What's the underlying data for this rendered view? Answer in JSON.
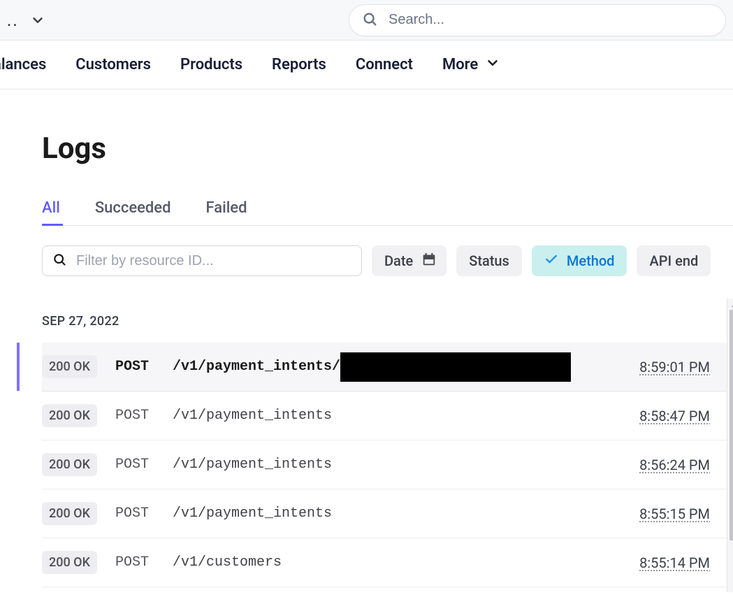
{
  "top": {
    "stub": "..",
    "search_placeholder": "Search..."
  },
  "nav": {
    "items": [
      "alances",
      "Customers",
      "Products",
      "Reports",
      "Connect",
      "More"
    ]
  },
  "page": {
    "title": "Logs"
  },
  "tabs": {
    "items": [
      "All",
      "Succeeded",
      "Failed"
    ],
    "active": 0
  },
  "filter": {
    "placeholder": "Filter by resource ID...",
    "chips": {
      "date": "Date",
      "status": "Status",
      "method": "Method",
      "api": "API end"
    }
  },
  "logs": {
    "date_header": "SEP 27, 2022",
    "rows": [
      {
        "status": "200 OK",
        "method": "POST",
        "path": "/v1/payment_intents/",
        "redacted": true,
        "time": "8:59:01 PM",
        "selected": true
      },
      {
        "status": "200 OK",
        "method": "POST",
        "path": "/v1/payment_intents",
        "redacted": false,
        "time": "8:58:47 PM",
        "selected": false
      },
      {
        "status": "200 OK",
        "method": "POST",
        "path": "/v1/payment_intents",
        "redacted": false,
        "time": "8:56:24 PM",
        "selected": false
      },
      {
        "status": "200 OK",
        "method": "POST",
        "path": "/v1/payment_intents",
        "redacted": false,
        "time": "8:55:15 PM",
        "selected": false
      },
      {
        "status": "200 OK",
        "method": "POST",
        "path": "/v1/customers",
        "redacted": false,
        "time": "8:55:14 PM",
        "selected": false
      }
    ]
  }
}
